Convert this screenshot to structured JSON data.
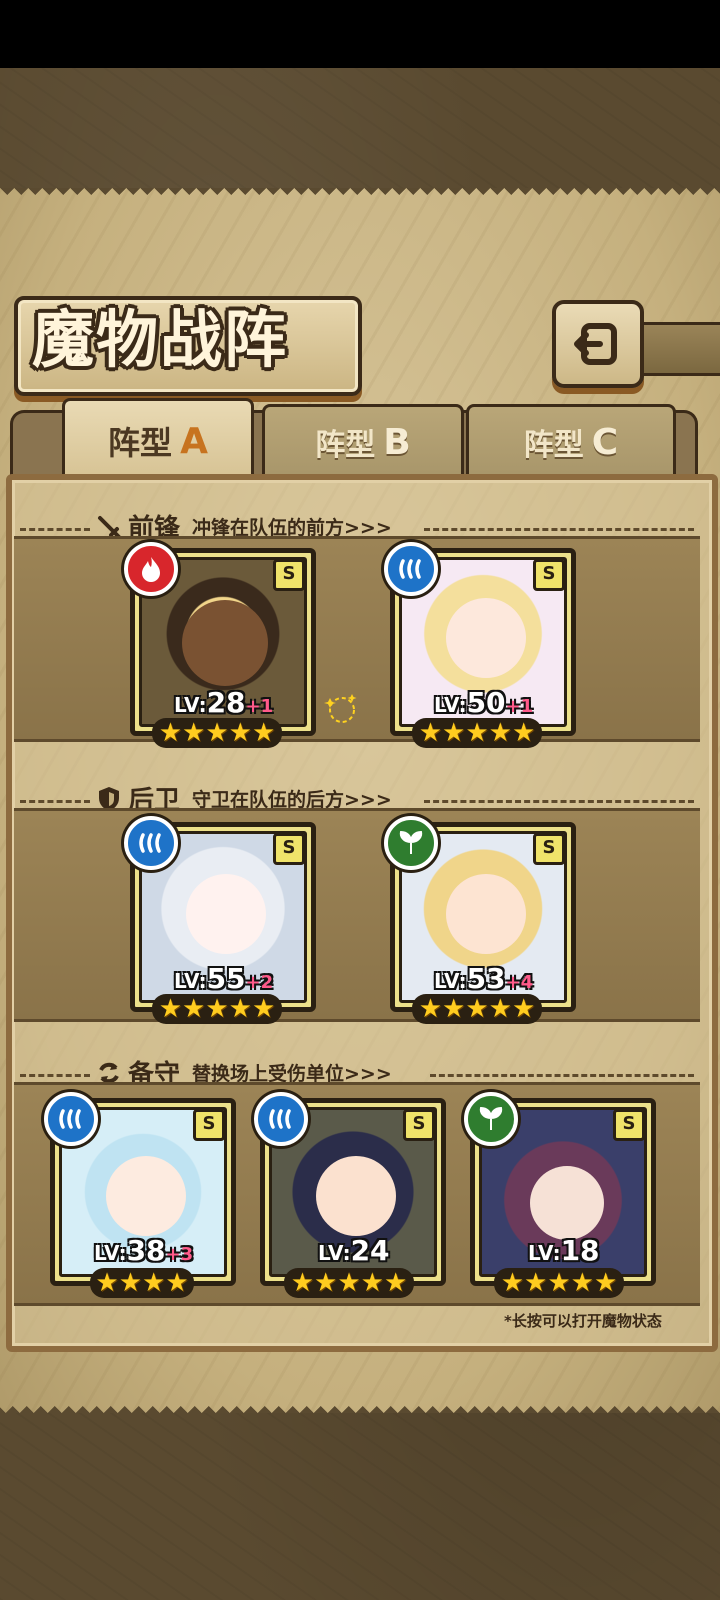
{
  "title": "魔物战阵",
  "tabs": [
    {
      "label": "阵型",
      "letter": "A",
      "active": true
    },
    {
      "label": "阵型",
      "letter": "B",
      "active": false
    },
    {
      "label": "阵型",
      "letter": "C",
      "active": false
    }
  ],
  "sections": {
    "front": {
      "title": "前锋",
      "desc": "冲锋在队伍的前方>>>",
      "icon": "sword-icon"
    },
    "rear": {
      "title": "后卫",
      "desc": "守卫在队伍的后方>>>",
      "icon": "shield-icon"
    },
    "reserve": {
      "title": "备守",
      "desc": "替换场上受伤单位>>>",
      "icon": "swap-icon"
    }
  },
  "units": {
    "front": [
      {
        "element": "fire-icon",
        "rank": "S",
        "lv_prefix": "LV:",
        "level": "28",
        "plus": "+1",
        "stars": 5
      },
      {
        "element": "water-icon",
        "rank": "S",
        "lv_prefix": "LV:",
        "level": "50",
        "plus": "+1",
        "stars": 5
      }
    ],
    "rear": [
      {
        "element": "water-icon",
        "rank": "S",
        "lv_prefix": "LV:",
        "level": "55",
        "plus": "+2",
        "stars": 5
      },
      {
        "element": "leaf-icon",
        "rank": "S",
        "lv_prefix": "LV:",
        "level": "53",
        "plus": "+4",
        "stars": 5
      }
    ],
    "reserve": [
      {
        "element": "water-icon",
        "rank": "S",
        "lv_prefix": "LV:",
        "level": "38",
        "plus": "+3",
        "stars": 4
      },
      {
        "element": "water-icon",
        "rank": "S",
        "lv_prefix": "LV:",
        "level": "24",
        "plus": "",
        "stars": 5
      },
      {
        "element": "leaf-icon",
        "rank": "S",
        "lv_prefix": "LV:",
        "level": "18",
        "plus": "",
        "stars": 5
      }
    ]
  },
  "hint": "*长按可以打开魔物状态",
  "colors": {
    "fire": "#d8262c",
    "water": "#1e73c8",
    "leaf": "#2f7d2f",
    "frame": "#ece08a"
  }
}
